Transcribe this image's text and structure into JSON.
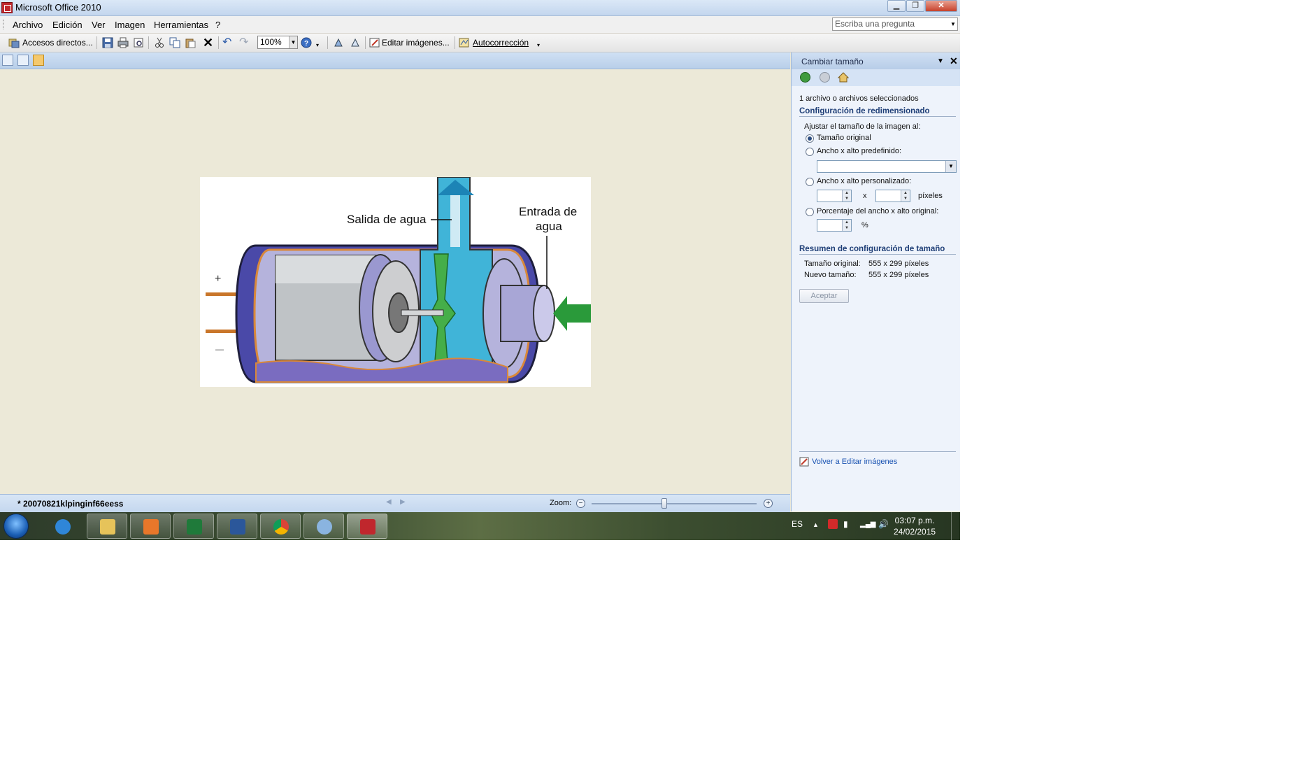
{
  "window": {
    "title": "Microsoft Office 2010",
    "min": "▁",
    "max": "❐",
    "close": "✕"
  },
  "menu": {
    "items": [
      "Archivo",
      "Edición",
      "Ver",
      "Imagen",
      "Herramientas",
      "?"
    ],
    "ask_placeholder": "Escriba una pregunta"
  },
  "toolbar": {
    "shortcuts": "Accesos directos...",
    "zoom": "100%",
    "edit_images": "Editar imágenes...",
    "autocorrect": "Autocorrección"
  },
  "diagram": {
    "label_out": "Salida de agua",
    "label_in_1": "Entrada de",
    "label_in_2": "agua",
    "plus": "+",
    "minus": "—"
  },
  "statusbar": {
    "filename": "* 20070821klpinginf66eess",
    "zoom_label": "Zoom:",
    "zoom_level": 0.44
  },
  "taskpane": {
    "title": "Cambiar tamaño",
    "selected": "1 archivo o archivos seleccionados",
    "section1": "Configuración de redimensionado",
    "fit_label": "Ajustar el tamaño de la imagen al:",
    "opt_original": "Tamaño original",
    "opt_predefined": "Ancho x alto predefinido:",
    "opt_custom": "Ancho x alto personalizado:",
    "x": "x",
    "pixels": "píxeles",
    "opt_percent": "Porcentaje del ancho x alto original:",
    "percent": "%",
    "section2": "Resumen de configuración de tamaño",
    "orig_label": "Tamaño original:",
    "orig_value": "555 x 299 píxeles",
    "new_label": "Nuevo tamaño:",
    "new_value": "555 x 299 píxeles",
    "accept": "Aceptar",
    "back_link": "Volver a Editar imágenes"
  },
  "taskbar": {
    "lang": "ES",
    "time": "03:07 p.m.",
    "date": "24/02/2015"
  },
  "colors": {
    "accent": "#1f3f77",
    "water": "#40b4d8",
    "motor_body": "#9a98d0",
    "inlet_arrow": "#2a9a3a"
  }
}
